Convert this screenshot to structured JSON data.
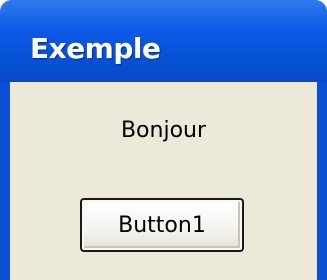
{
  "window": {
    "title": "Exemple"
  },
  "content": {
    "label": "Bonjour",
    "button_label": "Button1"
  },
  "colors": {
    "titlebar": "#0552d8",
    "client_background": "#ece9d8"
  }
}
